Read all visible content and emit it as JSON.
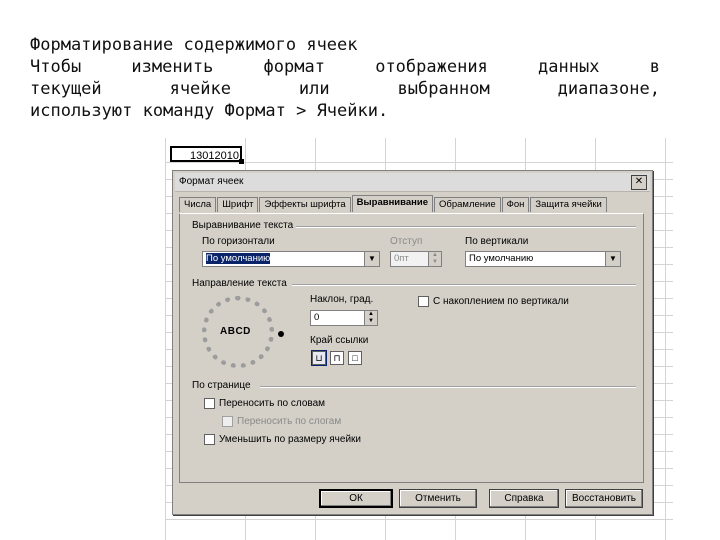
{
  "slide": {
    "line1": "Форматирование содержимого ячеек",
    "line2_words": [
      "Чтобы",
      "изменить",
      "формат",
      "отображения",
      "данных",
      "в"
    ],
    "line3_words": [
      "текущей",
      "ячейке",
      "или",
      "выбранном",
      "диапазоне,"
    ],
    "line4": "используют команду Формат > Ячейки."
  },
  "spreadsheet": {
    "active_cell_value": "13012010"
  },
  "dialog": {
    "title": "Формат ячеек",
    "close_glyph": "✕",
    "tabs": [
      "Числа",
      "Шрифт",
      "Эффекты шрифта",
      "Выравнивание",
      "Обрамление",
      "Фон",
      "Защита ячейки"
    ],
    "text_alignment": {
      "group_title": "Выравнивание текста",
      "horizontal_label": "По горизонтали",
      "horizontal_value": "По умолчанию",
      "indent_label": "Отступ",
      "indent_value": "0пт",
      "vertical_label": "По вертикали",
      "vertical_value": "По умолчанию"
    },
    "text_direction": {
      "group_title": "Направление текста",
      "dial_text": "ABCD",
      "angle_label": "Наклон, град.",
      "angle_value": "0",
      "stacked_label": "С накоплением по вертикали",
      "reference_edge_label": "Край ссылки"
    },
    "properties": {
      "group_title": "По странице",
      "wrap_label": "Переносить по словам",
      "hyphenation_label": "Переносить по слогам",
      "shrink_label": "Уменьшить по размеру ячейки"
    },
    "buttons": {
      "ok": "ОК",
      "cancel": "Отменить",
      "help": "Справка",
      "reset": "Восстановить"
    }
  }
}
